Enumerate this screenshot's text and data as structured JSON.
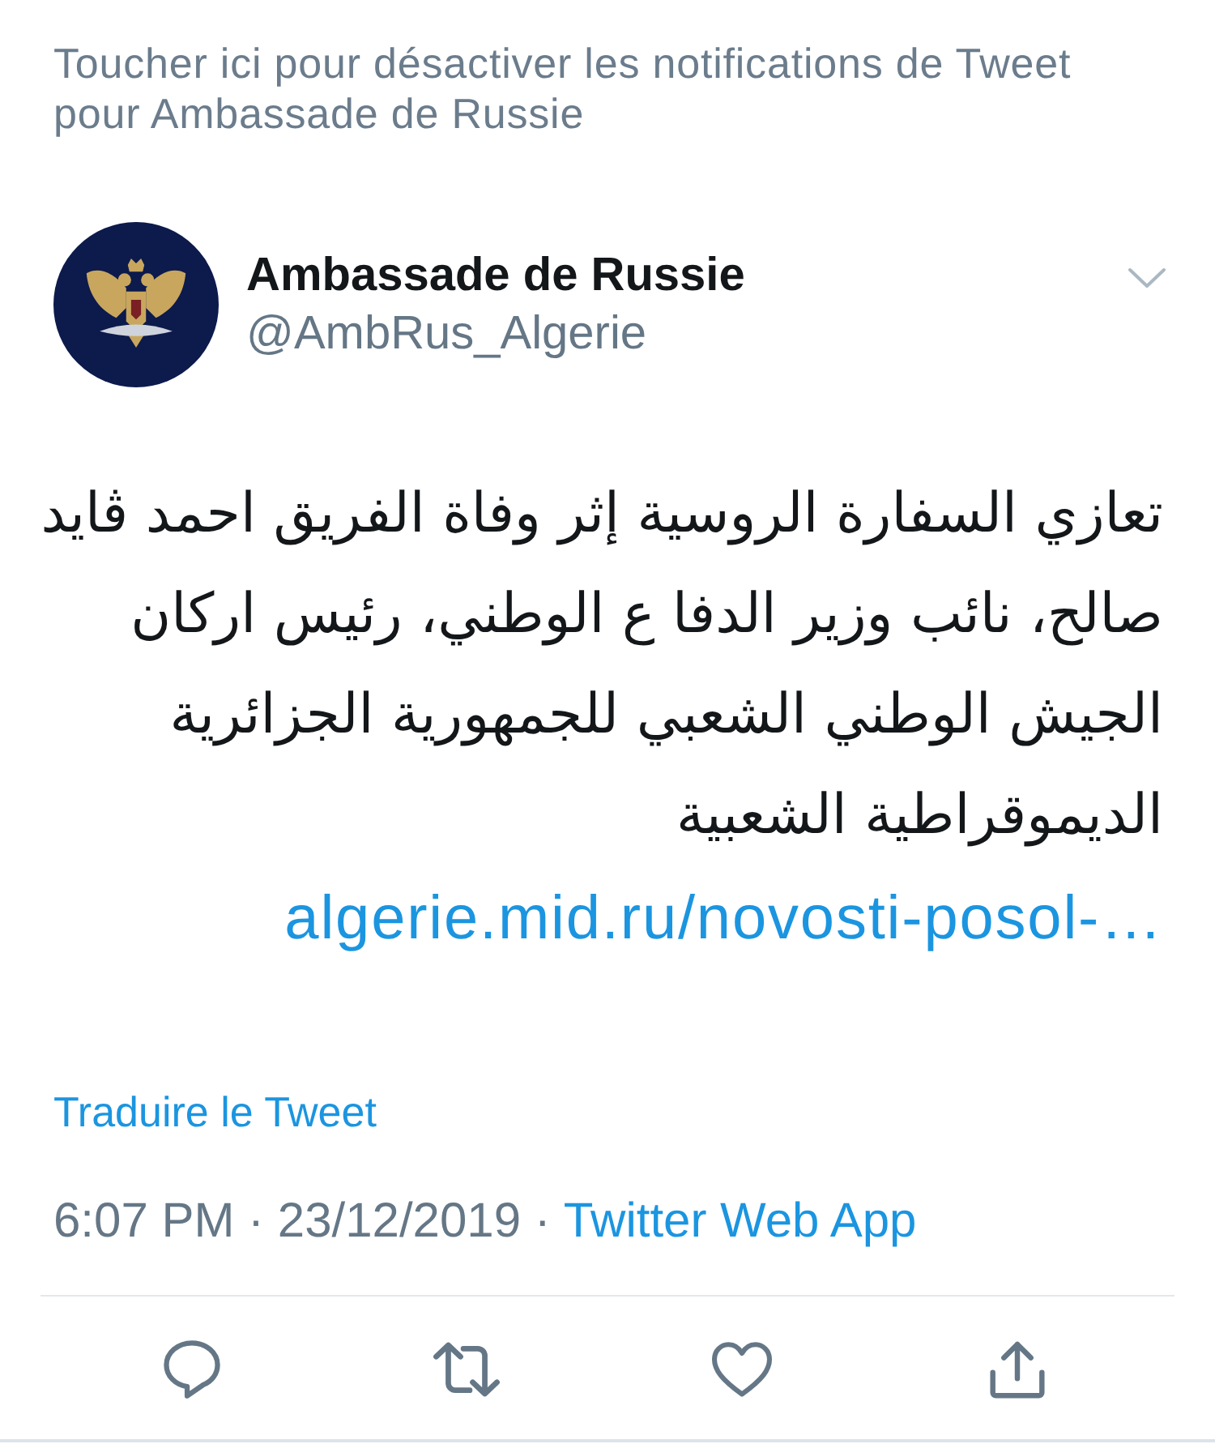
{
  "notification_banner": {
    "text": "Toucher ici pour désactiver les notifications de Tweet pour Ambassade de Russie"
  },
  "tweet": {
    "author": {
      "name": "Ambassade de Russie",
      "handle": "@AmbRus_Algerie"
    },
    "text": "تعازي السفارة الروسية إثر وفاة الفريق احمد ڨايد صالح، نائب وزير الدفا ع الوطني، رئيس اركان الجيش الوطني الشعبي للجمهورية الجزائرية الديموقراطية الشعبية",
    "link": "algerie.mid.ru/novosti-posol-…",
    "translate_link": "Traduire le Tweet",
    "timestamp": "6:07 PM · 23/12/2019 ·",
    "source": "Twitter Web App"
  },
  "actions": [
    {
      "kind": "reply"
    },
    {
      "kind": "retweet"
    },
    {
      "kind": "like"
    },
    {
      "kind": "share"
    }
  ]
}
